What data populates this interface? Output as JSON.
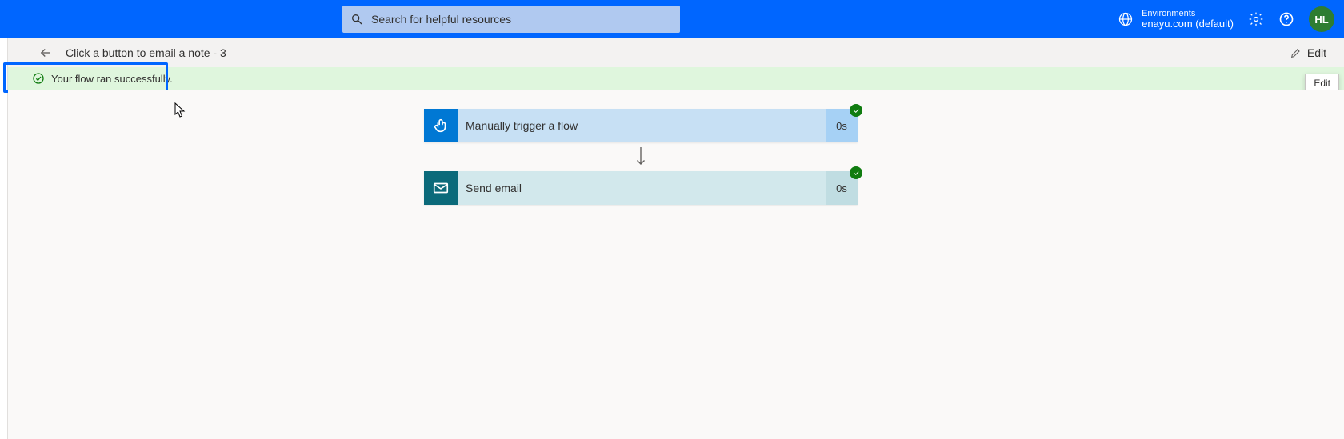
{
  "topbar": {
    "search_placeholder": "Search for helpful resources",
    "environments_label": "Environments",
    "environment_name": "enayu.com (default)",
    "avatar_initials": "HL"
  },
  "breadcrumb": {
    "title": "Click a button to email a note - 3",
    "edit_label": "Edit"
  },
  "banner": {
    "message": "Your flow ran successfully."
  },
  "tooltip": {
    "text": "Edit"
  },
  "flow": {
    "steps": [
      {
        "title": "Manually trigger a flow",
        "duration": "0s"
      },
      {
        "title": "Send email",
        "duration": "0s"
      }
    ]
  }
}
